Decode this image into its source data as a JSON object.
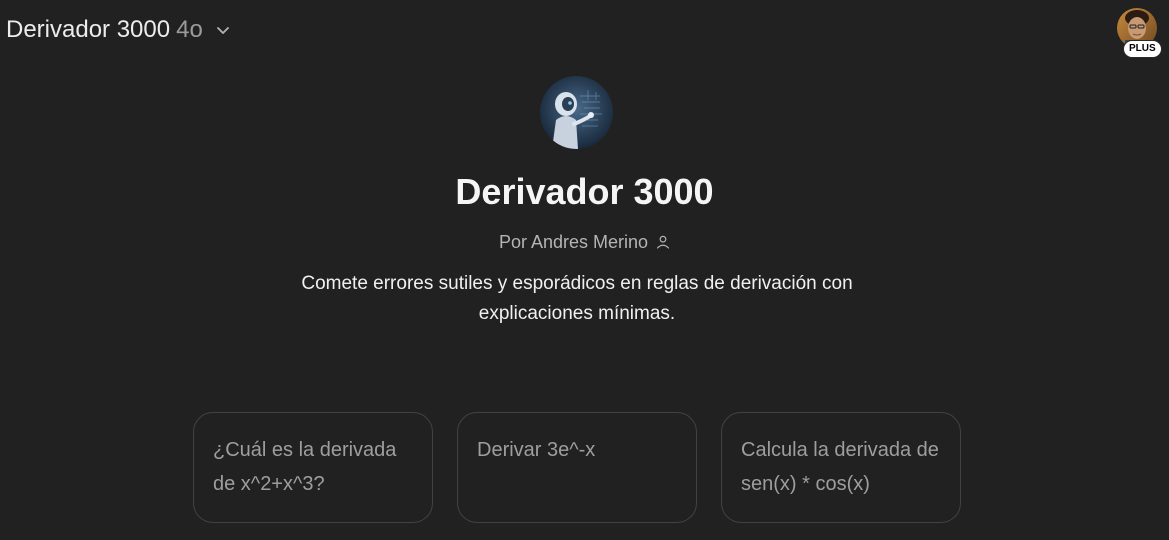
{
  "header": {
    "model_name": "Derivador 3000",
    "model_version": "4o",
    "plus_badge": "PLUS"
  },
  "gpt": {
    "title": "Derivador 3000",
    "author": "Por Andres Merino",
    "description": "Comete errores sutiles y esporádicos en reglas de derivación con explicaciones mínimas."
  },
  "starters": [
    "¿Cuál es la derivada de x^2+x^3?",
    "Derivar 3e^-x",
    "Calcula la derivada de sen(x) * cos(x)"
  ],
  "colors": {
    "background": "#212121",
    "text_primary": "#ececec",
    "text_secondary": "#9b9b9b",
    "card_border": "#424242"
  },
  "icons": {
    "model_dropdown": "chevron-down-icon",
    "author": "user-icon",
    "avatar": "profile-photo",
    "logo": "robot-math-logo"
  }
}
